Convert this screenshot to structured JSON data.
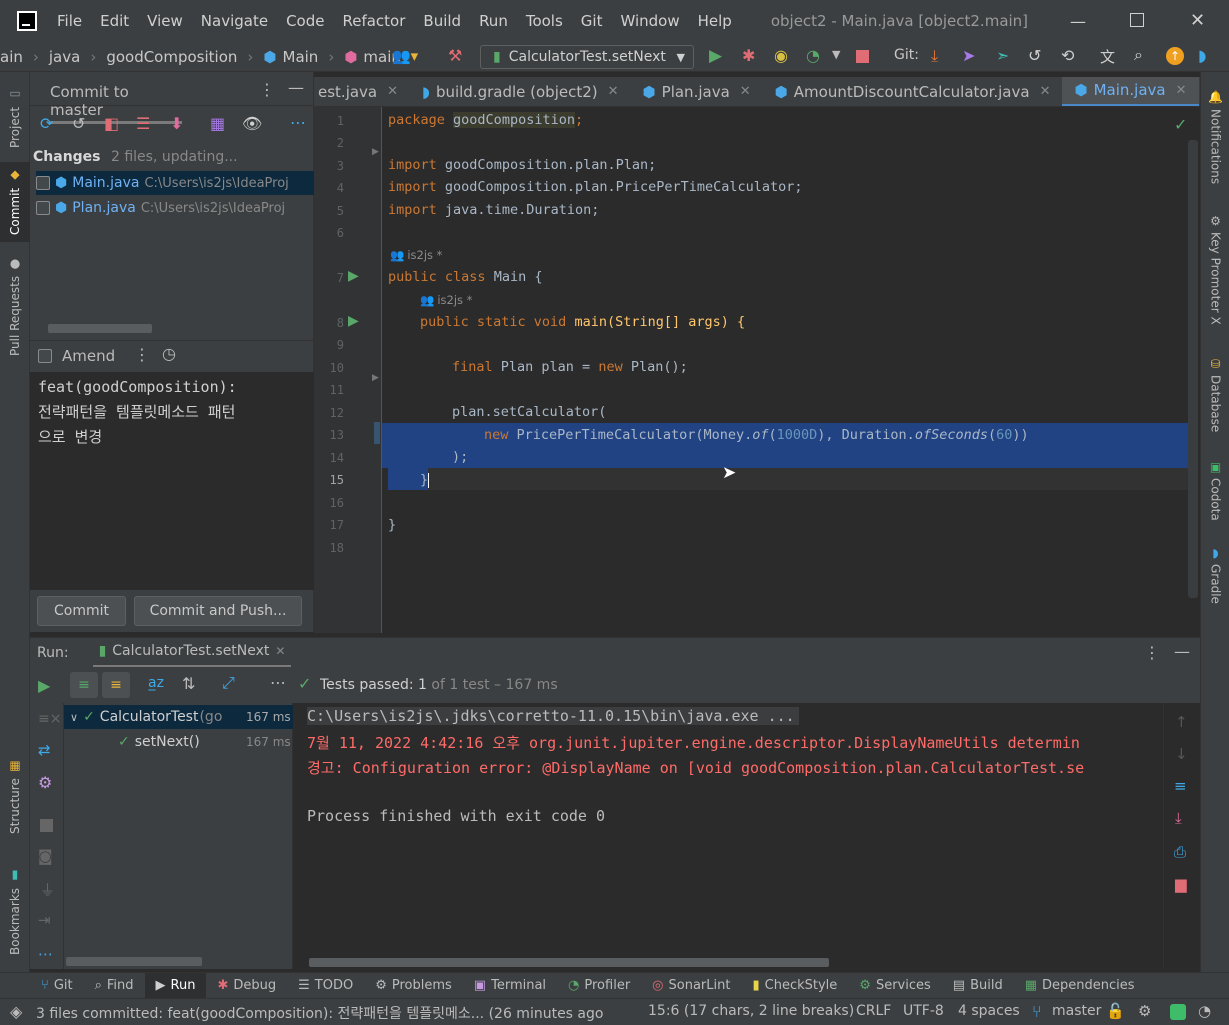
{
  "titlebar": {
    "menu": [
      "File",
      "Edit",
      "View",
      "Navigate",
      "Code",
      "Refactor",
      "Build",
      "Run",
      "Tools",
      "Git",
      "Window",
      "Help"
    ],
    "window_title": "object2 - Main.java [object2.main]"
  },
  "navbar": {
    "crumbs": [
      "ain",
      "java",
      "goodComposition",
      "Main",
      "main"
    ],
    "run_config": "CalculatorTest.setNext",
    "git_label": "Git:"
  },
  "left_stripe": {
    "project": "Project",
    "commit": "Commit",
    "pull_requests": "Pull Requests",
    "structure": "Structure",
    "bookmarks": "Bookmarks"
  },
  "right_stripe": {
    "notifications": "Notifications",
    "key_promoter": "Key Promoter X",
    "database": "Database",
    "codota": "Codota",
    "gradle": "Gradle"
  },
  "commit_panel": {
    "title": "Commit to master",
    "changes_label": "Changes",
    "changes_info": "2 files, updating...",
    "files": [
      {
        "name": "Main.java",
        "path": "C:\\Users\\is2js\\IdeaProj"
      },
      {
        "name": "Plan.java",
        "path": "C:\\Users\\is2js\\IdeaProj"
      }
    ],
    "amend_label": "Amend",
    "message_lines": [
      "feat(goodComposition):",
      "전략패턴을 템플릿메소드 패턴",
      "으로 변경"
    ],
    "commit_btn": "Commit",
    "commit_push_btn": "Commit and Push..."
  },
  "editor": {
    "tabs": [
      {
        "label": "est.java",
        "active": false
      },
      {
        "label": "build.gradle (object2)",
        "active": false
      },
      {
        "label": "Plan.java",
        "active": false
      },
      {
        "label": "AmountDiscountCalculator.java",
        "active": false
      },
      {
        "label": "Main.java",
        "active": true
      }
    ],
    "line_numbers": [
      "1",
      "2",
      "3",
      "4",
      "5",
      "6",
      "7",
      "8",
      "9",
      "10",
      "11",
      "12",
      "13",
      "14",
      "15",
      "16",
      "17",
      "18"
    ],
    "author_hint": "is2js *",
    "code": {
      "l1_kw": "package",
      "l1_rest": "goodComposition",
      "l1_end": ";",
      "l3_kw": "import",
      "l3_rest": "goodComposition.plan.Plan;",
      "l4_kw": "import",
      "l4_rest": "goodComposition.plan.PricePerTimeCalculator;",
      "l5_kw": "import",
      "l5_rest": "java.time.Duration;",
      "l7_kw": "public class",
      "l7_rest": "Main {",
      "l8_kw": "public static void",
      "l8_rest": "main(String[] args) {",
      "l10_kw1": "final",
      "l10_mid": "Plan plan =",
      "l10_kw2": "new",
      "l10_rest": "Plan();",
      "l12": "plan.setCalculator(",
      "l13_kw": "new",
      "l13_a": "PricePerTimeCalculator(Money.",
      "l13_of": "of",
      "l13_b": "(",
      "l13_num1": "1000D",
      "l13_c": "), Duration.",
      "l13_sec": "ofSeconds",
      "l13_d": "(",
      "l13_num2": "60",
      "l13_e": "))",
      "l14": ");",
      "l15": "}",
      "l17": "}"
    }
  },
  "run_panel": {
    "label": "Run:",
    "tab": "CalculatorTest.setNext",
    "tests_passed": "Tests passed:",
    "passed_count": "1",
    "passed_of": "of 1 test – 167 ms",
    "tree": [
      {
        "name": "CalculatorTest",
        "suffix": "(go",
        "time": "167 ms"
      },
      {
        "name": "setNext()",
        "time": "167 ms"
      }
    ],
    "console": [
      {
        "text": "C:\\Users\\is2js\\.jdks\\corretto-11.0.15\\bin\\java.exe ...",
        "color": "#bbbbbb"
      },
      {
        "text": "7월 11, 2022 4:42:16 오후 org.junit.jupiter.engine.descriptor.DisplayNameUtils determin",
        "color": "#ff6b68"
      },
      {
        "text": "경고: Configuration error: @DisplayName on [void goodComposition.plan.CalculatorTest.se",
        "color": "#ff6b68"
      },
      {
        "text": "",
        "color": "#bbbbbb"
      },
      {
        "text": "Process finished with exit code 0",
        "color": "#bbbbbb"
      }
    ]
  },
  "tool_windows": [
    "Git",
    "Find",
    "Run",
    "Debug",
    "TODO",
    "Problems",
    "Terminal",
    "Profiler",
    "SonarLint",
    "CheckStyle",
    "Services",
    "Build",
    "Dependencies"
  ],
  "status": {
    "message": "3 files committed: feat(goodComposition): 전략패턴을 템플릿메소... (26 minutes ago",
    "position": "15:6 (17 chars, 2 line breaks)",
    "line_sep": "CRLF",
    "encoding": "UTF-8",
    "indent": "4 spaces",
    "branch": "master"
  },
  "colors": {
    "accent": "#4a88c7",
    "selection": "#214283",
    "keyword": "#cc7832",
    "number": "#6897bb",
    "error": "#ff6b68",
    "green": "#59a869"
  }
}
